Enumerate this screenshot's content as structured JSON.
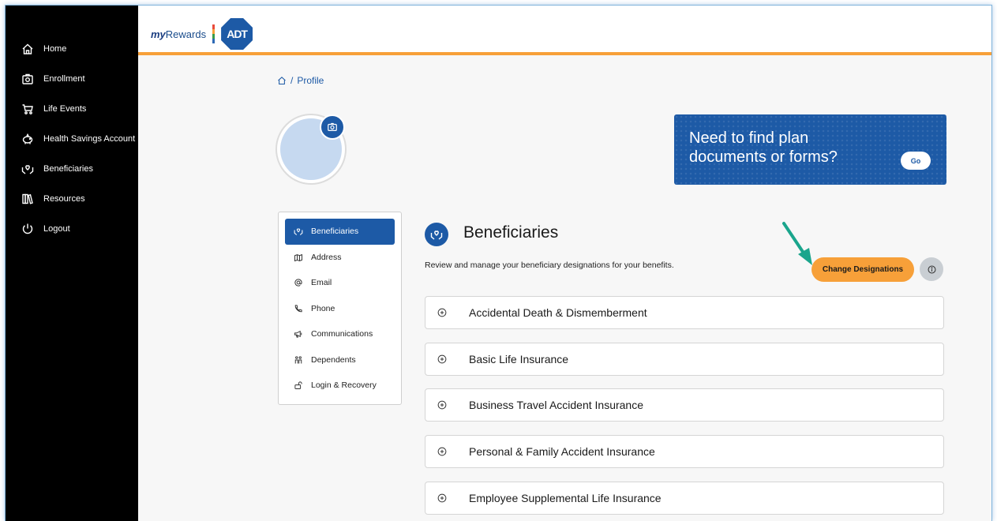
{
  "sidebar": {
    "items": [
      {
        "label": "Home",
        "icon": "home-icon"
      },
      {
        "label": "Enrollment",
        "icon": "enrollment-icon"
      },
      {
        "label": "Life Events",
        "icon": "stroller-icon"
      },
      {
        "label": "Health Savings Account",
        "icon": "piggy-bank-icon"
      },
      {
        "label": "Beneficiaries",
        "icon": "hands-heart-icon"
      },
      {
        "label": "Resources",
        "icon": "books-icon"
      },
      {
        "label": "Logout",
        "icon": "power-icon"
      }
    ]
  },
  "header": {
    "logo_prefix": "my",
    "logo_suffix": "Rewards",
    "brand": "ADT",
    "accent_color": "#f7a039",
    "brand_color": "#1d5aa6"
  },
  "breadcrumb": {
    "separator": "/",
    "current": "Profile"
  },
  "banner": {
    "text": "Need to find plan documents or forms?",
    "button": "Go"
  },
  "profile_menu": {
    "items": [
      {
        "label": "Beneficiaries",
        "icon": "hands-heart-icon",
        "active": true
      },
      {
        "label": "Address",
        "icon": "map-icon"
      },
      {
        "label": "Email",
        "icon": "at-icon"
      },
      {
        "label": "Phone",
        "icon": "phone-icon"
      },
      {
        "label": "Communications",
        "icon": "megaphone-icon"
      },
      {
        "label": "Dependents",
        "icon": "people-icon"
      },
      {
        "label": "Login & Recovery",
        "icon": "lock-icon"
      }
    ]
  },
  "section": {
    "title": "Beneficiaries",
    "description": "Review and manage your beneficiary designations for your benefits.",
    "change_button": "Change Designations",
    "info_icon": "info-icon"
  },
  "accordions": [
    {
      "label": "Accidental Death & Dismemberment"
    },
    {
      "label": "Basic Life Insurance"
    },
    {
      "label": "Business Travel Accident Insurance"
    },
    {
      "label": "Personal & Family Accident Insurance"
    },
    {
      "label": "Employee Supplemental Life Insurance"
    }
  ]
}
